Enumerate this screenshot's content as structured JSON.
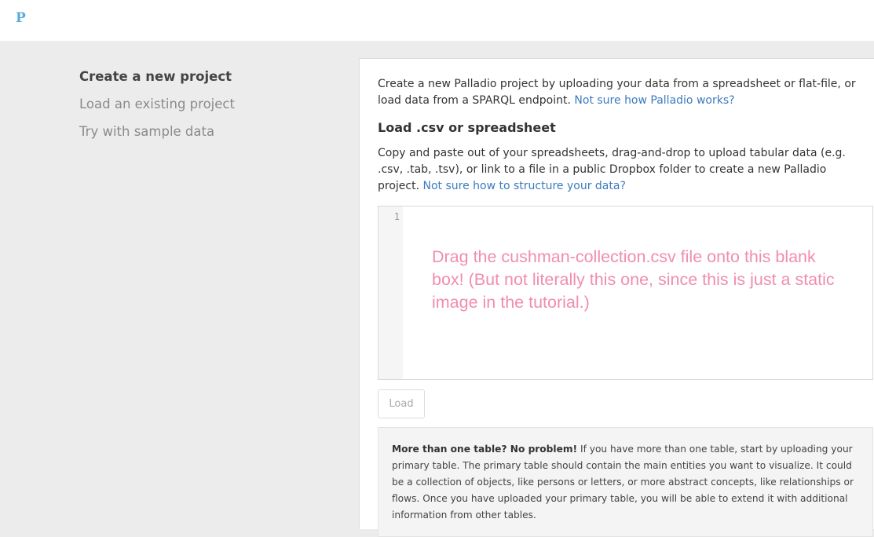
{
  "app": {
    "logo": "P"
  },
  "sidebar": {
    "items": [
      {
        "label": "Create a new project",
        "active": true
      },
      {
        "label": "Load an existing project",
        "active": false
      },
      {
        "label": "Try with sample data",
        "active": false
      }
    ]
  },
  "main": {
    "intro_text": "Create a new Palladio project by uploading your data from a spreadsheet or flat-file, or load data from a SPARQL endpoint.",
    "intro_link": "Not sure how Palladio works?",
    "section_title": "Load .csv or spreadsheet",
    "description": "Copy and paste out of your spreadsheets, drag-and-drop to upload tabular data (e.g. .csv, .tab, .tsv), or link to a file in a public Dropbox folder to create a new Palladio project.",
    "description_link": "Not sure how to structure your data?",
    "editor": {
      "line_number": "1",
      "overlay_text": "Drag the cushman-collection.csv file onto this blank box! (But not literally this one, since this is just a static image in the tutorial.)"
    },
    "load_button": "Load",
    "note": {
      "bold": "More than one table? No problem!",
      "text": "If you have more than one table, start by uploading your primary table. The primary table should contain the main entities you want to visualize. It could be a collection of objects, like persons or letters, or more abstract concepts, like relationships or flows. Once you have uploaded your primary table, you will be able to extend it with additional information from other tables."
    }
  },
  "colors": {
    "accent": "#3b7bbf",
    "logo": "#5aacd8",
    "overlay": "#f08db0",
    "background": "#ececec"
  }
}
